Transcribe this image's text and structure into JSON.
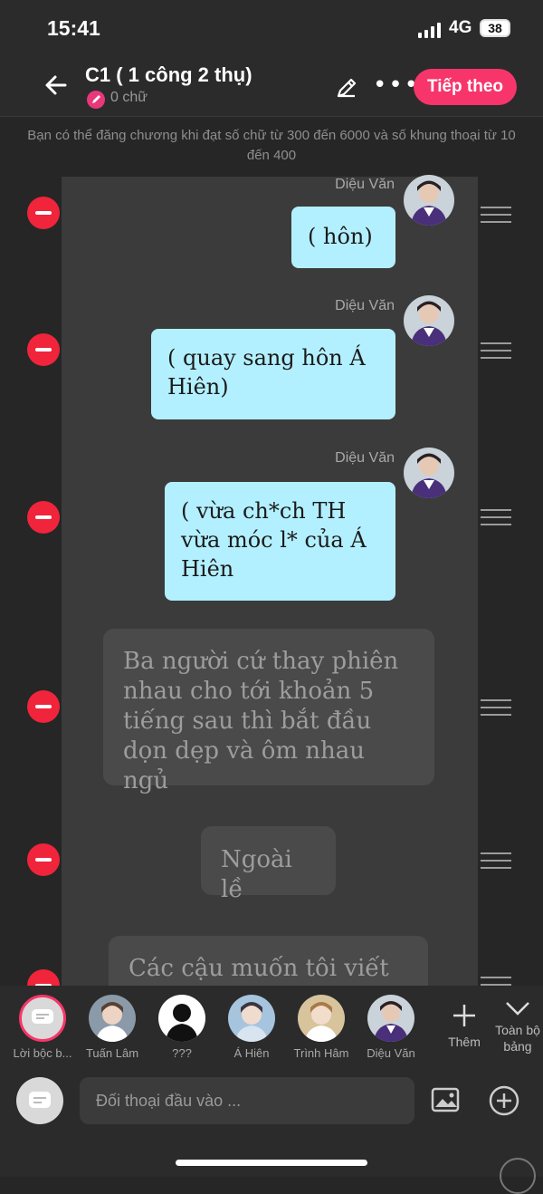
{
  "status": {
    "time": "15:41",
    "network": "4G",
    "battery": "38"
  },
  "header": {
    "title": "C1 ( 1 công 2 thụ)",
    "word_count": "0 chữ",
    "next_label": "Tiếp theo"
  },
  "notice": "Bạn có thể đăng chương khi đạt số chữ từ 300 đến 6000 và số khung thoại từ 10 đến 400",
  "messages": [
    {
      "speaker": "Diệu Văn",
      "text": "( hôn)"
    },
    {
      "speaker": "Diệu Văn",
      "text": "( quay sang hôn Á Hiên)"
    },
    {
      "speaker": "Diệu Văn",
      "text": "( vừa ch*ch TH vừa móc l* của Á Hiên"
    },
    {
      "speaker": "",
      "text": "Ba người cứ thay phiên nhau cho tới khoản 5 tiếng sau thì bắt đầu dọn dẹp và ôm nhau ngủ"
    },
    {
      "speaker": "",
      "text": "Ngoài lề"
    },
    {
      "speaker": "",
      "text": "Các cậu muốn tôi viết ai"
    }
  ],
  "characters": [
    {
      "label": "Lời bộc b...",
      "icon": "narration-icon"
    },
    {
      "label": "Tuấn Lâm"
    },
    {
      "label": "???"
    },
    {
      "label": "Á Hiên"
    },
    {
      "label": "Trình Hâm"
    },
    {
      "label": "Diệu Văn"
    }
  ],
  "toolbar": {
    "add_label": "Thêm",
    "all_label": "Toàn bộ bảng"
  },
  "input": {
    "placeholder": "Đối thoại đầu vào ..."
  },
  "colors": {
    "accent": "#f7356b",
    "bubble": "#b3f0ff",
    "delete": "#f0243b"
  }
}
